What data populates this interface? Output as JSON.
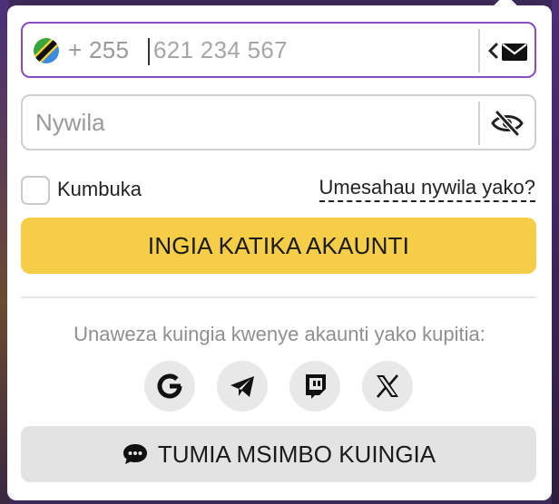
{
  "phone_field": {
    "dial_code": "+ 255",
    "placeholder": "621 234 567",
    "country_flag": "tanzania-flag"
  },
  "password_field": {
    "placeholder": "Nywila"
  },
  "remember_label": "Kumbuka",
  "forgot_link": "Umesahau nywila yako?",
  "login_button": "INGIA KATIKA AKAUNTI",
  "social_prompt": "Unaweza kuingia kwenye akaunti yako kupitia:",
  "social_icons": [
    "google-icon",
    "telegram-icon",
    "twitch-icon",
    "x-icon"
  ],
  "code_button": "TUMIA MSIMBO KUINGIA",
  "colors": {
    "accent_yellow": "#f5cd47",
    "focus_border": "#8a4bc0",
    "secondary_button": "#e3e3e3"
  }
}
